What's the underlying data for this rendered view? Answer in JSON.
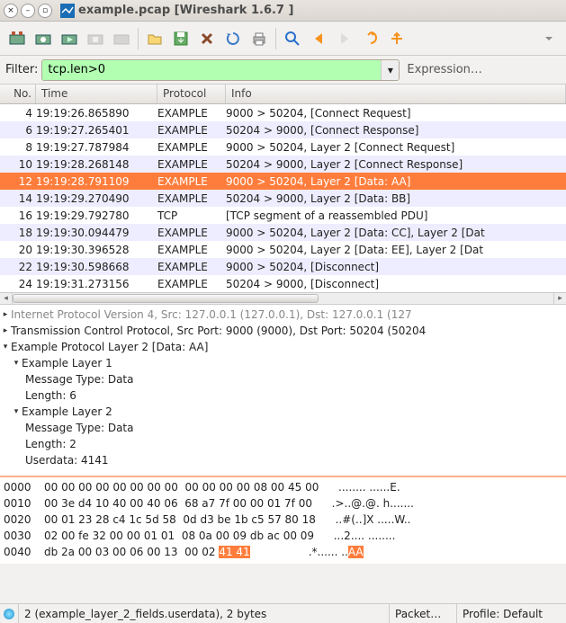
{
  "window": {
    "title": "example.pcap   [Wireshark 1.6.7 ]"
  },
  "filter": {
    "label": "Filter:",
    "value": "tcp.len>0",
    "expression": "Expression…"
  },
  "columns": {
    "no": "No.",
    "time": "Time",
    "protocol": "Protocol",
    "info": "Info"
  },
  "packets": [
    {
      "no": "4",
      "time": "19:19:26.865890",
      "proto": "EXAMPLE",
      "info": "9000 > 50204, [Connect Request]"
    },
    {
      "no": "6",
      "time": "19:19:27.265401",
      "proto": "EXAMPLE",
      "info": "50204 > 9000, [Connect Response]"
    },
    {
      "no": "8",
      "time": "19:19:27.787984",
      "proto": "EXAMPLE",
      "info": "9000 > 50204, Layer 2 [Connect Request]"
    },
    {
      "no": "10",
      "time": "19:19:28.268148",
      "proto": "EXAMPLE",
      "info": "50204 > 9000, Layer 2 [Connect Response]"
    },
    {
      "no": "12",
      "time": "19:19:28.791109",
      "proto": "EXAMPLE",
      "info": "9000 > 50204, Layer 2 [Data: AA]",
      "sel": true
    },
    {
      "no": "14",
      "time": "19:19:29.270490",
      "proto": "EXAMPLE",
      "info": "50204 > 9000, Layer 2 [Data: BB]"
    },
    {
      "no": "16",
      "time": "19:19:29.792780",
      "proto": "TCP",
      "info": "[TCP segment of a reassembled PDU]"
    },
    {
      "no": "18",
      "time": "19:19:30.094479",
      "proto": "EXAMPLE",
      "info": "9000 > 50204, Layer 2 [Data: CC], Layer 2 [Dat"
    },
    {
      "no": "20",
      "time": "19:19:30.396528",
      "proto": "EXAMPLE",
      "info": "9000 > 50204, Layer 2 [Data: EE], Layer 2 [Dat"
    },
    {
      "no": "22",
      "time": "19:19:30.598668",
      "proto": "EXAMPLE",
      "info": "9000 > 50204, [Disconnect]"
    },
    {
      "no": "24",
      "time": "19:19:31.273156",
      "proto": "EXAMPLE",
      "info": "50204 > 9000, [Disconnect]"
    }
  ],
  "tree": {
    "l0": "Internet Protocol Version 4, Src: 127.0.0.1 (127.0.0.1), Dst: 127.0.0.1 (127",
    "l1": "Transmission Control Protocol, Src Port: 9000 (9000), Dst Port: 50204 (50204",
    "l2": "Example Protocol Layer 2 [Data: AA]",
    "l3": "Example Layer 1",
    "l4": "Message Type: Data",
    "l5": "Length: 6",
    "l6": "Example Layer 2",
    "l7": "Message Type: Data",
    "l8": "Length: 2",
    "l9": "Userdata: 4141"
  },
  "hex": {
    "r0o": "0000",
    "r0h": "00 00 00 00 00 00 00 00  00 00 00 00 08 00 45 00",
    "r0a": "........ ......E.",
    "r1o": "0010",
    "r1h": "00 3e d4 10 40 00 40 06  68 a7 7f 00 00 01 7f 00",
    "r1a": ".>..@.@. h.......",
    "r2o": "0020",
    "r2h": "00 01 23 28 c4 1c 5d 58  0d d3 be 1b c5 57 80 18",
    "r2a": "..#(..]X .....W..",
    "r3o": "0030",
    "r3h": "02 00 fe 32 00 00 01 01  08 0a 00 09 db ac 00 09",
    "r3a": "...2.... ........",
    "r4o": "0040",
    "r4h": "db 2a 00 03 00 06 00 13  00 02 ",
    "r4a": ".*...... ..",
    "r4h2": "41 41",
    "r4a2": "AA"
  },
  "status": {
    "left": "2 (example_layer_2_fields.userdata), 2 bytes",
    "mid": "Packet…",
    "right": "Profile: Default"
  }
}
